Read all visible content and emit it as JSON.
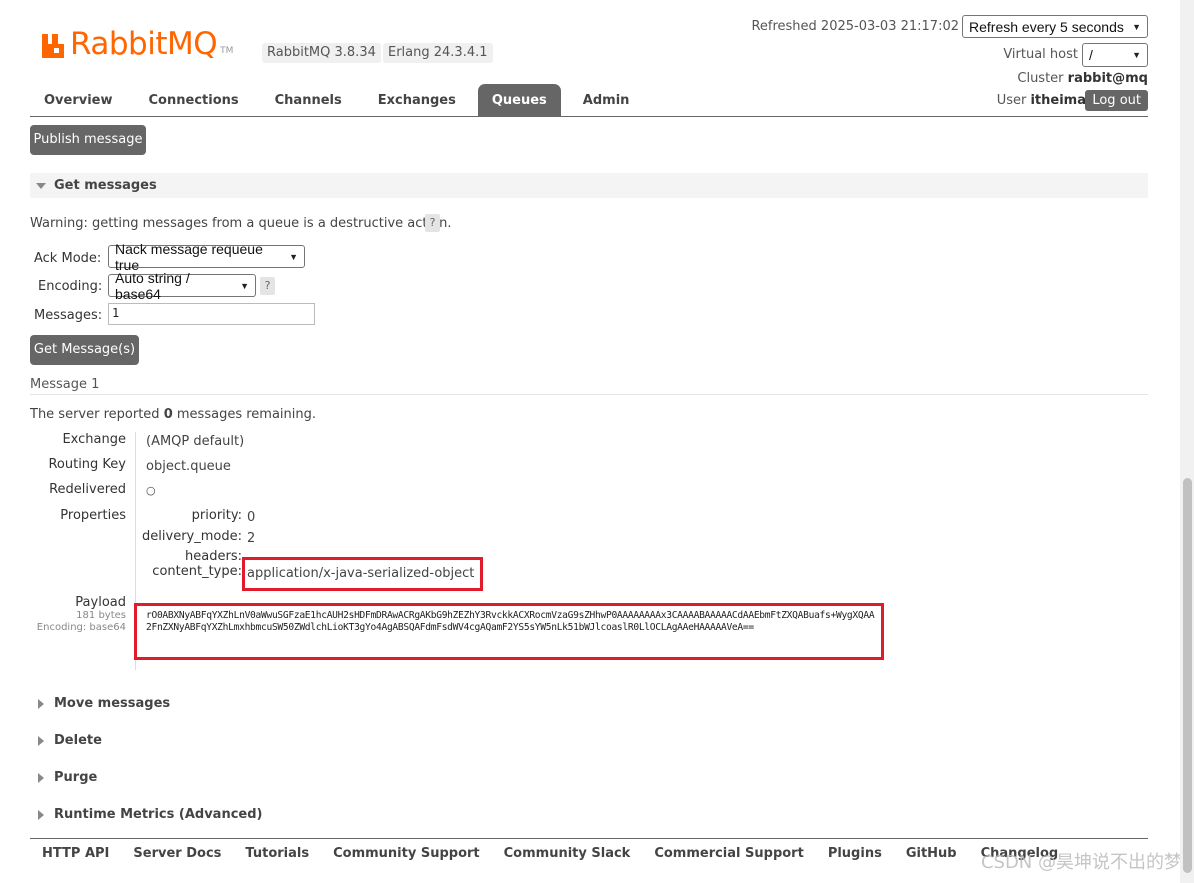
{
  "header": {
    "logo_text": "RabbitMQ",
    "logo_tm": "TM",
    "version_badge": "RabbitMQ 3.8.34",
    "erlang_badge": "Erlang 24.3.4.1",
    "refreshed": "Refreshed 2025-03-03 21:17:02",
    "refresh_select": "Refresh every 5 seconds",
    "virtual_host_label": "Virtual host",
    "virtual_host_value": "/",
    "cluster_label": "Cluster",
    "cluster_value": "rabbit@mq",
    "user_label": "User",
    "user_value": "itheima",
    "logout_label": "Log out",
    "accent_color": "#ff6600"
  },
  "tabs": [
    {
      "label": "Overview",
      "active": false
    },
    {
      "label": "Connections",
      "active": false
    },
    {
      "label": "Channels",
      "active": false
    },
    {
      "label": "Exchanges",
      "active": false
    },
    {
      "label": "Queues",
      "active": true
    },
    {
      "label": "Admin",
      "active": false
    }
  ],
  "publish_button": "Publish message",
  "get_messages": {
    "title": "Get messages",
    "warning": "Warning: getting messages from a queue is a destructive action.",
    "help": "?",
    "ack_mode_label": "Ack Mode:",
    "ack_mode_value": "Nack message requeue true",
    "encoding_label": "Encoding:",
    "encoding_value": "Auto string / base64",
    "messages_label": "Messages:",
    "messages_value": "1",
    "get_button": "Get Message(s)"
  },
  "message": {
    "heading": "Message 1",
    "server_reported_pre": "The server reported",
    "remaining_count": "0",
    "server_reported_post": "messages remaining.",
    "exchange_label": "Exchange",
    "exchange_value": "(AMQP default)",
    "routing_key_label": "Routing Key",
    "routing_key_value": "object.queue",
    "redelivered_label": "Redelivered",
    "redelivered_value": "○",
    "properties_label": "Properties",
    "properties": {
      "priority_label": "priority:",
      "priority_value": "0",
      "delivery_mode_label": "delivery_mode:",
      "delivery_mode_value": "2",
      "headers_label": "headers:",
      "content_type_label": "content_type:",
      "content_type_value": "application/x-java-serialized-object"
    },
    "payload_label": "Payload",
    "payload_size": "181 bytes",
    "payload_encoding": "Encoding: base64",
    "payload_value": "rO0ABXNyABFqYXZhLnV0aWwuSGFzaE1hcAUH2sHDFmDRAwACRgAKbG9hZEZhY3RvckkACXRocmVzaG9sZHhwP0AAAAAAAAx3CAAAABAAAAACdAAEbmFtZXQABuafs+WygXQAA2FnZXNyABFqYXZhLmxhbmcuSW50ZWdlchLioKT3gYo4AgABSQAFdmFsdWV4cgAQamF2YS5sYW5nLk51bWJlcoaslR0LlOCLAgAAeHAAAAAVeA=="
  },
  "collapsed_sections": [
    "Move messages",
    "Delete",
    "Purge",
    "Runtime Metrics (Advanced)"
  ],
  "footer_links": [
    "HTTP API",
    "Server Docs",
    "Tutorials",
    "Community Support",
    "Community Slack",
    "Commercial Support",
    "Plugins",
    "GitHub",
    "Changelog"
  ],
  "watermark": "CSDN @昊坤说不出的梦"
}
